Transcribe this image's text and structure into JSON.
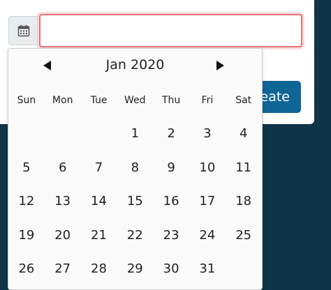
{
  "input": {
    "value": "",
    "placeholder": ""
  },
  "create_button": {
    "label": "reate"
  },
  "datepicker": {
    "month_label": "Jan 2020",
    "weekdays": [
      "Sun",
      "Mon",
      "Tue",
      "Wed",
      "Thu",
      "Fri",
      "Sat"
    ],
    "weeks": [
      [
        "",
        "",
        "",
        "1",
        "2",
        "3",
        "4"
      ],
      [
        "5",
        "6",
        "7",
        "8",
        "9",
        "10",
        "11"
      ],
      [
        "12",
        "13",
        "14",
        "15",
        "16",
        "17",
        "18"
      ],
      [
        "19",
        "20",
        "21",
        "22",
        "23",
        "24",
        "25"
      ],
      [
        "26",
        "27",
        "28",
        "29",
        "30",
        "31",
        ""
      ]
    ]
  },
  "icons": {
    "calendar": "calendar-icon",
    "prev": "prev-month-icon",
    "next": "next-month-icon"
  },
  "colors": {
    "accent": "#0f6596",
    "background": "#0f3447",
    "invalid_border": "#e57373"
  }
}
